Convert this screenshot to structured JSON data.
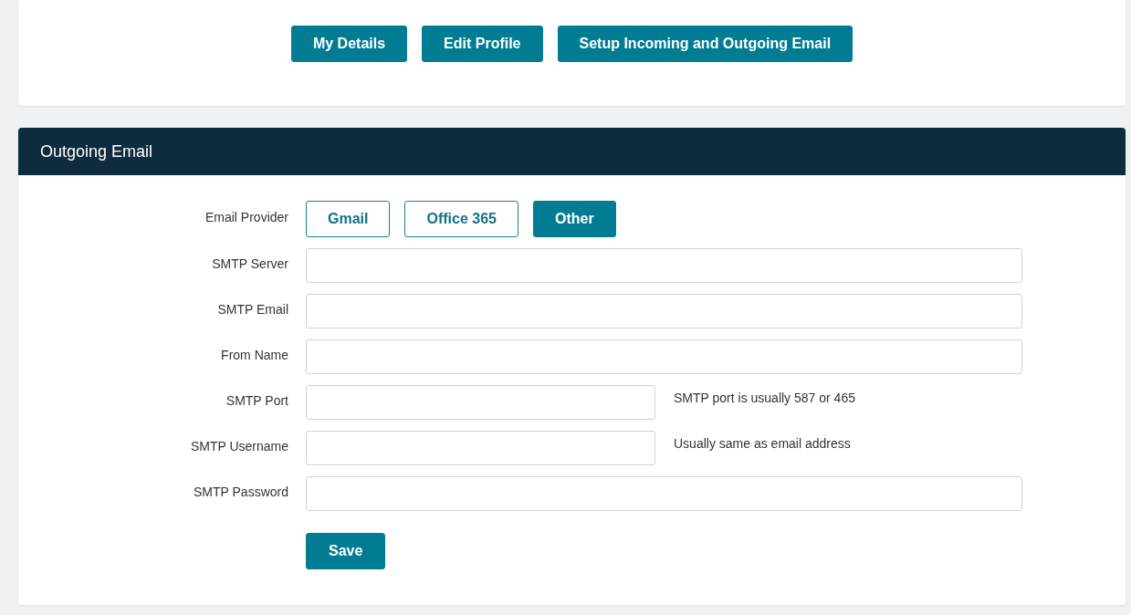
{
  "nav_buttons": [
    {
      "label": "My Details"
    },
    {
      "label": "Edit Profile"
    },
    {
      "label": "Setup Incoming and Outgoing Email"
    }
  ],
  "section": {
    "title": "Outgoing Email"
  },
  "provider": {
    "label": "Email Provider",
    "options": [
      {
        "label": "Gmail",
        "selected": false
      },
      {
        "label": "Office 365",
        "selected": false
      },
      {
        "label": "Other",
        "selected": true
      }
    ]
  },
  "fields": [
    {
      "label": "SMTP Server",
      "kind": "full"
    },
    {
      "label": "SMTP Email",
      "kind": "full"
    },
    {
      "label": "From Name",
      "kind": "full"
    },
    {
      "label": "SMTP Port",
      "kind": "half",
      "hint": "SMTP port is usually 587 or 465"
    },
    {
      "label": "SMTP Username",
      "kind": "half",
      "hint": "Usually same as email address"
    },
    {
      "label": "SMTP Password",
      "kind": "full"
    }
  ],
  "save_button": {
    "label": "Save"
  }
}
